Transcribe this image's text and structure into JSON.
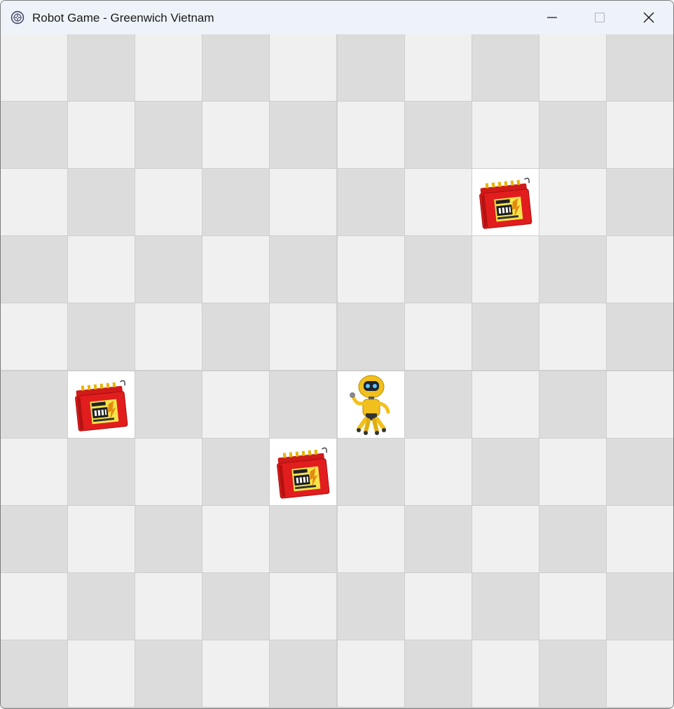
{
  "window": {
    "title": "Robot Game - Greenwich Vietnam",
    "icon": "compass-icon",
    "controls": [
      "minimize-icon",
      "maximize-icon",
      "close-icon"
    ]
  },
  "board": {
    "rows": 10,
    "cols": 10,
    "colors": {
      "light": "#f0f0f0",
      "dark": "#dcdcdc",
      "grid": "#cfcfcf",
      "occupied": "#ffffff"
    },
    "robot": {
      "row": 5,
      "col": 5,
      "icon": "robot-icon"
    },
    "batteries": [
      {
        "row": 2,
        "col": 7,
        "icon": "battery-icon"
      },
      {
        "row": 5,
        "col": 1,
        "icon": "battery-icon"
      },
      {
        "row": 6,
        "col": 4,
        "icon": "battery-icon"
      }
    ]
  }
}
